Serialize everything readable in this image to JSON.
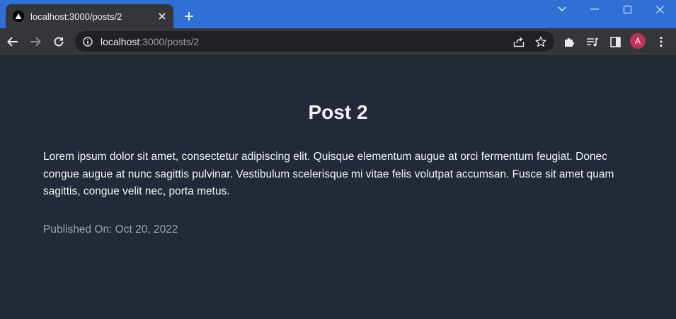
{
  "browser": {
    "tab": {
      "title": "localhost:3000/posts/2"
    },
    "url": {
      "host": "localhost",
      "path": ":3000/posts/2"
    },
    "profile_initial": "A"
  },
  "post": {
    "title": "Post 2",
    "body": "Lorem ipsum dolor sit amet, consectetur adipiscing elit. Quisque elementum augue at orci fermentum feugiat. Donec congue augue at nunc sagittis pulvinar. Vestibulum scelerisque mi vitae felis volutpat accumsan. Fusce sit amet quam sagittis, congue velit nec, porta metus.",
    "published": "Published On: Oct 20, 2022"
  },
  "colors": {
    "titlebar": "#2f70d6",
    "toolbar": "#35363a",
    "page_bg": "#222937",
    "avatar": "#c0305b"
  }
}
